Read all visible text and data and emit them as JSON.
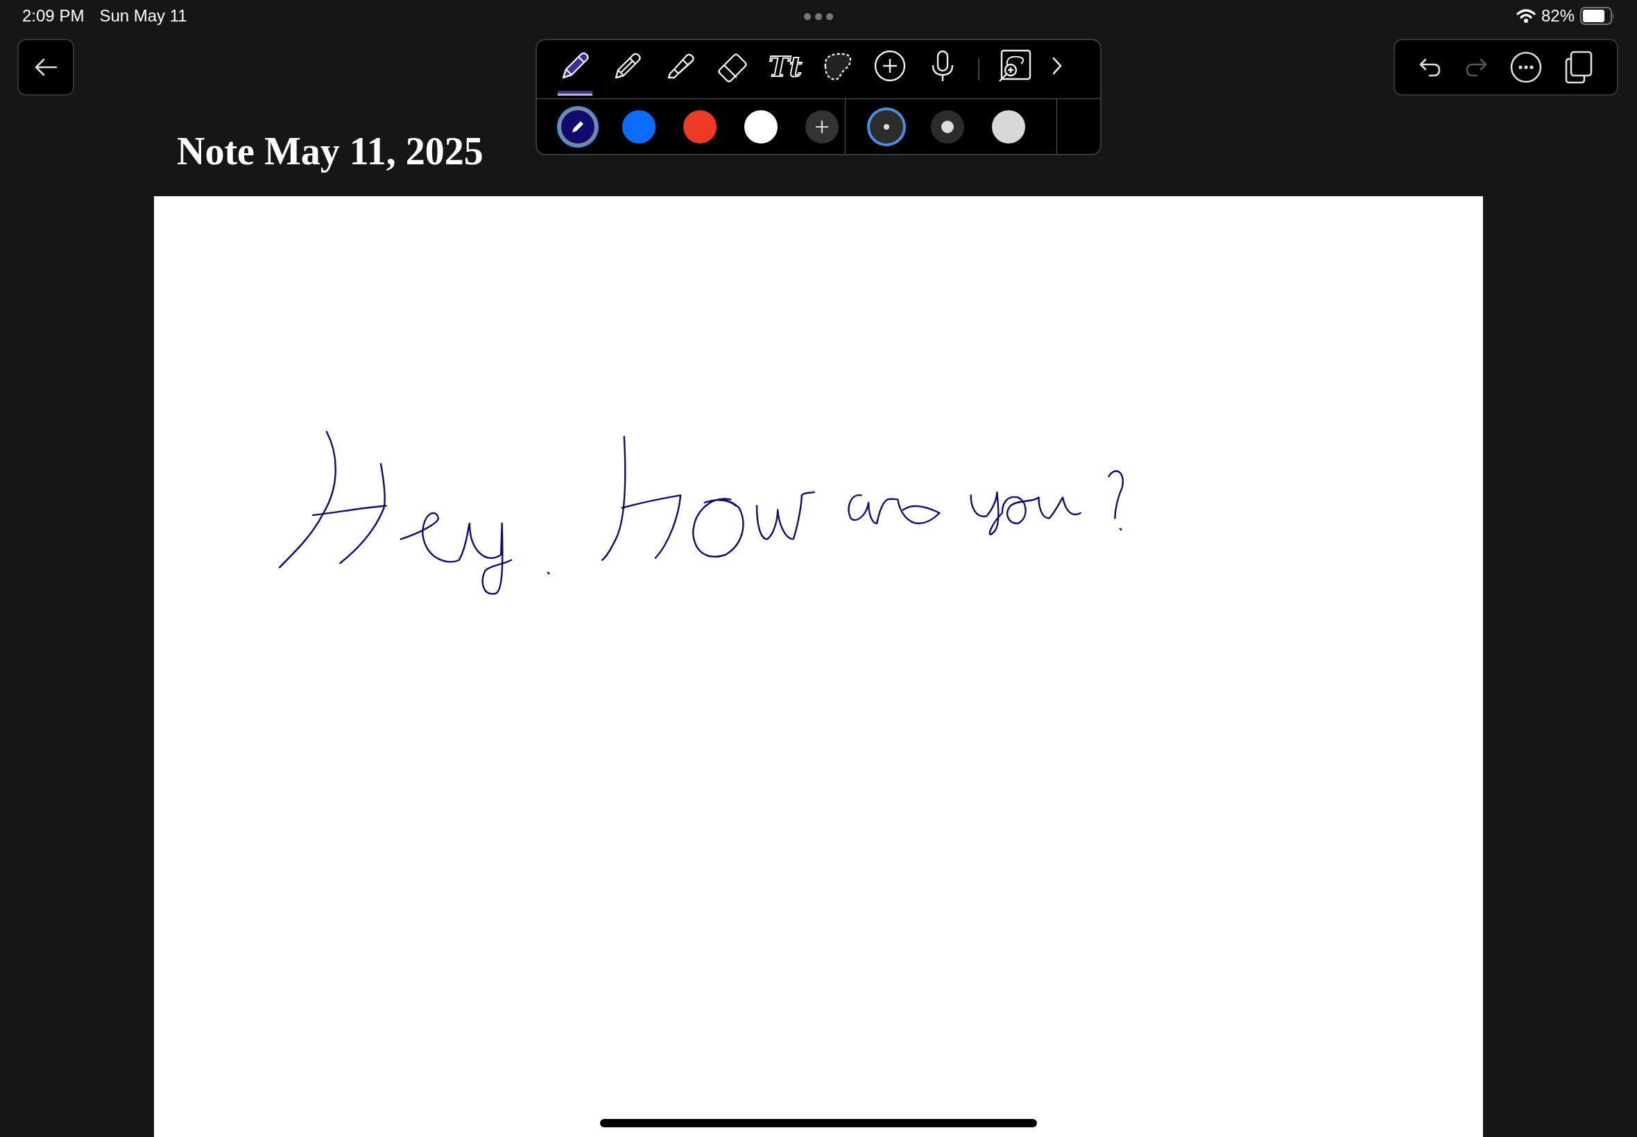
{
  "status_bar": {
    "time": "2:09 PM",
    "date": "Sun May 11",
    "battery": "82%"
  },
  "title": "Note May 11, 2025",
  "tools": [
    {
      "kind": "pen",
      "selected": true
    },
    {
      "kind": "pencil",
      "selected": false
    },
    {
      "kind": "marker",
      "selected": false
    },
    {
      "kind": "eraser",
      "selected": false
    },
    {
      "kind": "text",
      "label": "Tt",
      "selected": false
    },
    {
      "kind": "lasso",
      "selected": false
    },
    {
      "kind": "add",
      "selected": false
    },
    {
      "kind": "mic",
      "selected": false
    },
    {
      "kind": "divider"
    },
    {
      "kind": "zoom",
      "selected": false
    },
    {
      "kind": "more",
      "selected": false
    }
  ],
  "colors": [
    {
      "color": "#120a6e",
      "selected": true
    },
    {
      "color": "#0a6cff",
      "selected": false
    },
    {
      "color": "#ee3a24",
      "selected": false
    },
    {
      "color": "#ffffff",
      "selected": false
    }
  ],
  "sizes": [
    {
      "kind": "small",
      "selected": true
    },
    {
      "kind": "medium",
      "selected": false
    },
    {
      "kind": "large",
      "selected": false
    }
  ],
  "actions": [
    {
      "kind": "undo",
      "disabled": false
    },
    {
      "kind": "redo",
      "disabled": true
    },
    {
      "kind": "more",
      "disabled": false
    },
    {
      "kind": "pages",
      "disabled": false
    }
  ]
}
